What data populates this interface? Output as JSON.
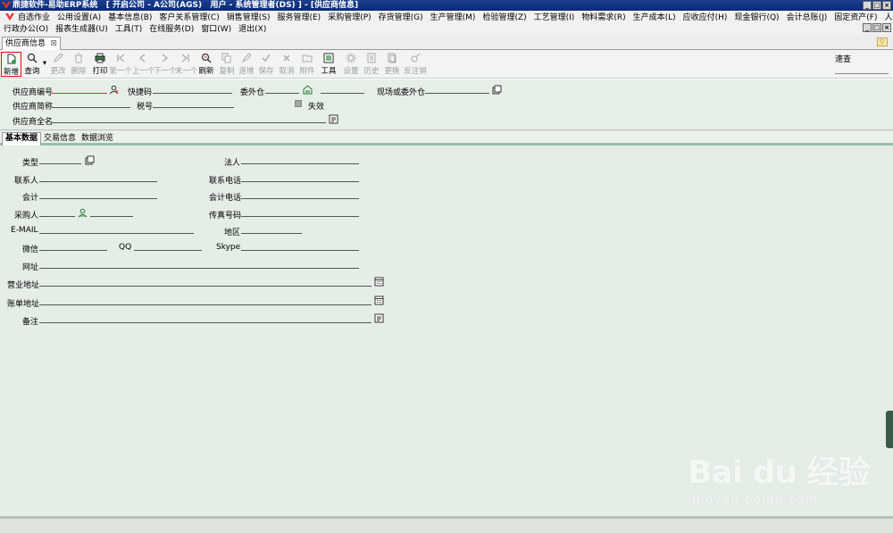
{
  "window": {
    "title": "鼎捷软件-易助ERP系统   [ 开启公司 - A公司(AGS)   用户 - 系统管理者(DS) ] - [供应商信息]",
    "controls": [
      "_",
      "□",
      "×"
    ]
  },
  "menu": {
    "row1": [
      "自选作业",
      "公用设置(A)",
      "基本信息(B)",
      "客户关系管理(C)",
      "销售管理(S)",
      "服务管理(E)",
      "采购管理(P)",
      "存货管理(G)",
      "生产管理(M)",
      "检验管理(Z)",
      "工艺管理(I)",
      "物料需求(R)",
      "生产成本(L)",
      "应收应付(H)",
      "现金银行(Q)",
      "会计总账(J)",
      "固定资产(F)",
      "人事管理(Y)"
    ],
    "row2": [
      "行政办公(O)",
      "报表生成器(U)",
      "工具(T)",
      "在线服务(D)",
      "窗口(W)",
      "退出(X)"
    ]
  },
  "doc_tab": {
    "label": "供应商信息",
    "close": "⊠"
  },
  "toolbar": {
    "new": "新增",
    "query": "查询",
    "edit": "更改",
    "delete": "删除",
    "print": "打印",
    "first": "第一个",
    "prev": "上一个",
    "next": "下一个",
    "last": "末一个",
    "refresh": "刷新",
    "copy": "复制",
    "batch_add": "连增",
    "save": "保存",
    "cancel": "取消",
    "attach": "附件",
    "tools": "工具",
    "settings": "设置",
    "history": "历史",
    "replace": "更换",
    "unaudit": "反注销",
    "quick_label": "速查"
  },
  "header": {
    "supplier_no": "供应商编号",
    "quick_code": "快捷码",
    "outsource_warehouse": "委外仓",
    "site_or_outsource": "现场或委外仓",
    "short_name": "供应商简称",
    "tax_no": "税号",
    "invalid": "失效",
    "full_name": "供应商全名"
  },
  "subtabs": [
    "基本数据",
    "交易信息",
    "数据浏览"
  ],
  "form": {
    "type": "类型",
    "legal_person": "法人",
    "contact": "联系人",
    "contact_phone": "联系电话",
    "accountant": "会计",
    "accountant_phone": "会计电话",
    "buyer": "采购人",
    "fax": "传真号码",
    "email": "E-MAIL",
    "region": "地区",
    "wechat": "微信",
    "qq": "QQ",
    "skype": "Skype",
    "website": "网址",
    "business_address": "营业地址",
    "billing_address": "账单地址",
    "remark": "备注"
  },
  "watermark": {
    "logo": "Bai du 经验",
    "url": "jingyan.baidu.com"
  },
  "colors": {
    "titlebar": "#0b2a74",
    "form_bg": "#e4ede6",
    "highlight": "#e01010",
    "tab_accent": "#98c0a8"
  }
}
